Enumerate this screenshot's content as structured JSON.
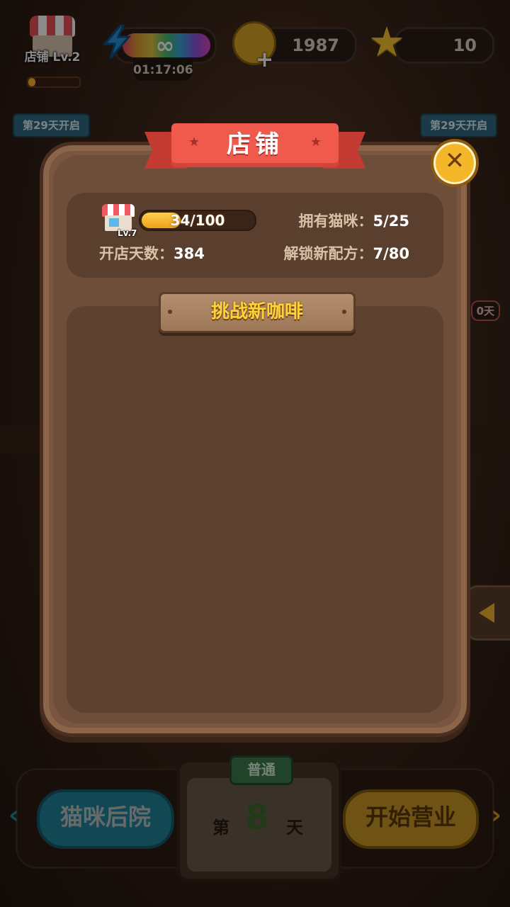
{
  "hud": {
    "shop_level": "店铺 Lv.2",
    "shop_progress": 0.14,
    "energy": "∞",
    "timer": "01:17:06",
    "coins": "1987",
    "stars": "10"
  },
  "side": {
    "left_tag": "第29天开启",
    "right_tag": "第29天开启",
    "right_badge": "0天"
  },
  "modal": {
    "title": "店铺",
    "shop_icon_level": "Lv.7",
    "xp_text": "34/100",
    "xp_ratio": 0.34,
    "cats_label": "拥有猫咪：",
    "cats_value": "5/25",
    "days_label": "开店天数：",
    "days_value": "384",
    "recipes_label": "解锁新配方：",
    "recipes_value": "7/80",
    "challenge_title": "挑战新咖啡"
  },
  "bottom": {
    "backyard_button": "猫咪后院",
    "mode": "普通",
    "day_prefix": "第",
    "day_number": "8",
    "day_suffix": "天",
    "open_button": "开始营业"
  },
  "colors": {
    "modal_bg": "#7a5640",
    "ribbon": "#ef5a4d",
    "accent_gold": "#f5b72a",
    "xp_fill": "#f0a01c",
    "plank_text": "#ffd23a"
  }
}
